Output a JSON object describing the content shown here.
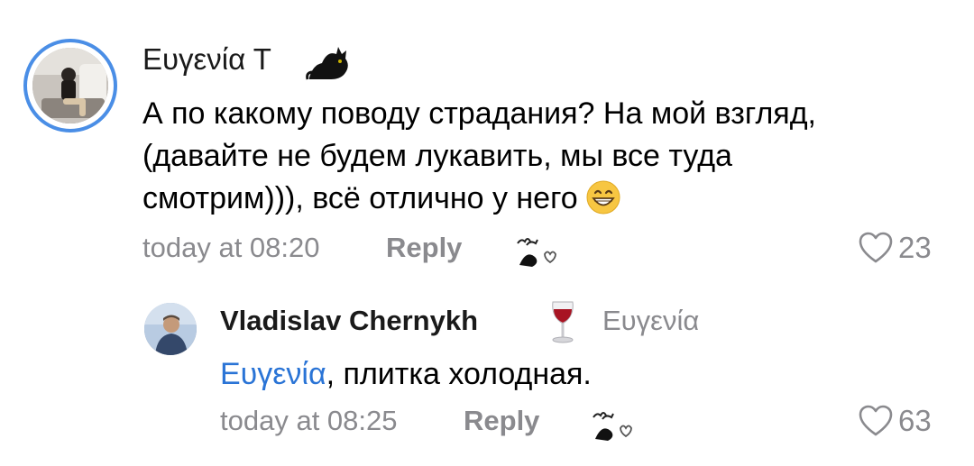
{
  "comments": [
    {
      "author": "Ευγενία Τ",
      "text_lines": [
        "А по какому поводу страдания? На мой взгляд,",
        "(давайте не будем лукавить, мы все туда",
        "смотрим))), всё отлично у него"
      ],
      "time": "today at 08:20",
      "reply_label": "Reply",
      "likes": "23"
    }
  ],
  "reply": {
    "author": "Vladislav Chernykh",
    "reply_to": "Ευγενία",
    "mention": "Ευγενία",
    "text": ", плитка холодная.",
    "time": "today at 08:25",
    "reply_label": "Reply",
    "likes": "63"
  },
  "icons": {
    "author_badge_1": "black-cat-icon",
    "author_badge_2": "wine-glass-icon",
    "emoji": "grinning-face-icon",
    "reaction": "add-reaction-icon",
    "like": "heart-outline-icon"
  },
  "colors": {
    "accent_link": "#2a74d6",
    "avatar_ring": "#4a8ee6",
    "secondary_text": "#8a8a8e"
  }
}
